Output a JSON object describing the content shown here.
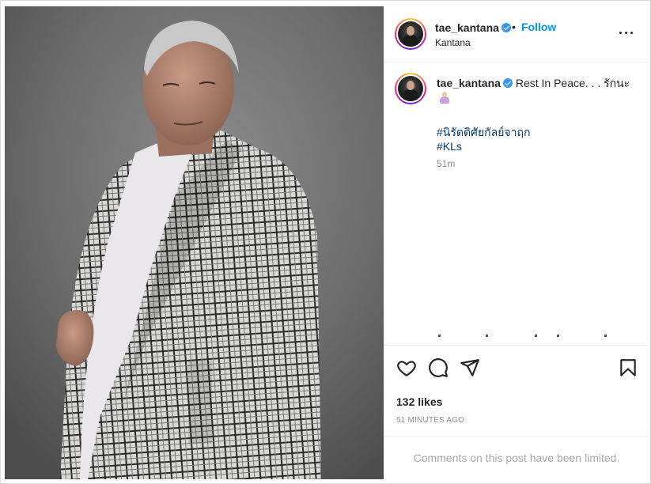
{
  "post": {
    "username": "tae_kantana",
    "follow_label": "Follow",
    "dot": "•",
    "subtitle": "Kantana",
    "caption_text": "Rest In Peace. . . รักนะ",
    "hashtags": [
      "#นิรัตติศัยกัลย์จาฤก",
      "#KLs"
    ],
    "caption_time": "51m",
    "likes": "132 likes",
    "time_ago": "51 MINUTES AGO",
    "comments_notice": "Comments on this post have been limited."
  },
  "icons": {
    "verified": "verified-badge-icon",
    "more": "more-options-icon",
    "like": "heart-icon",
    "comment": "comment-icon",
    "share": "send-icon",
    "save": "bookmark-icon"
  },
  "colors": {
    "follow": "#0095f6",
    "verified": "#3897f0",
    "hashtag": "#00376b",
    "muted": "#8e8e8e"
  }
}
